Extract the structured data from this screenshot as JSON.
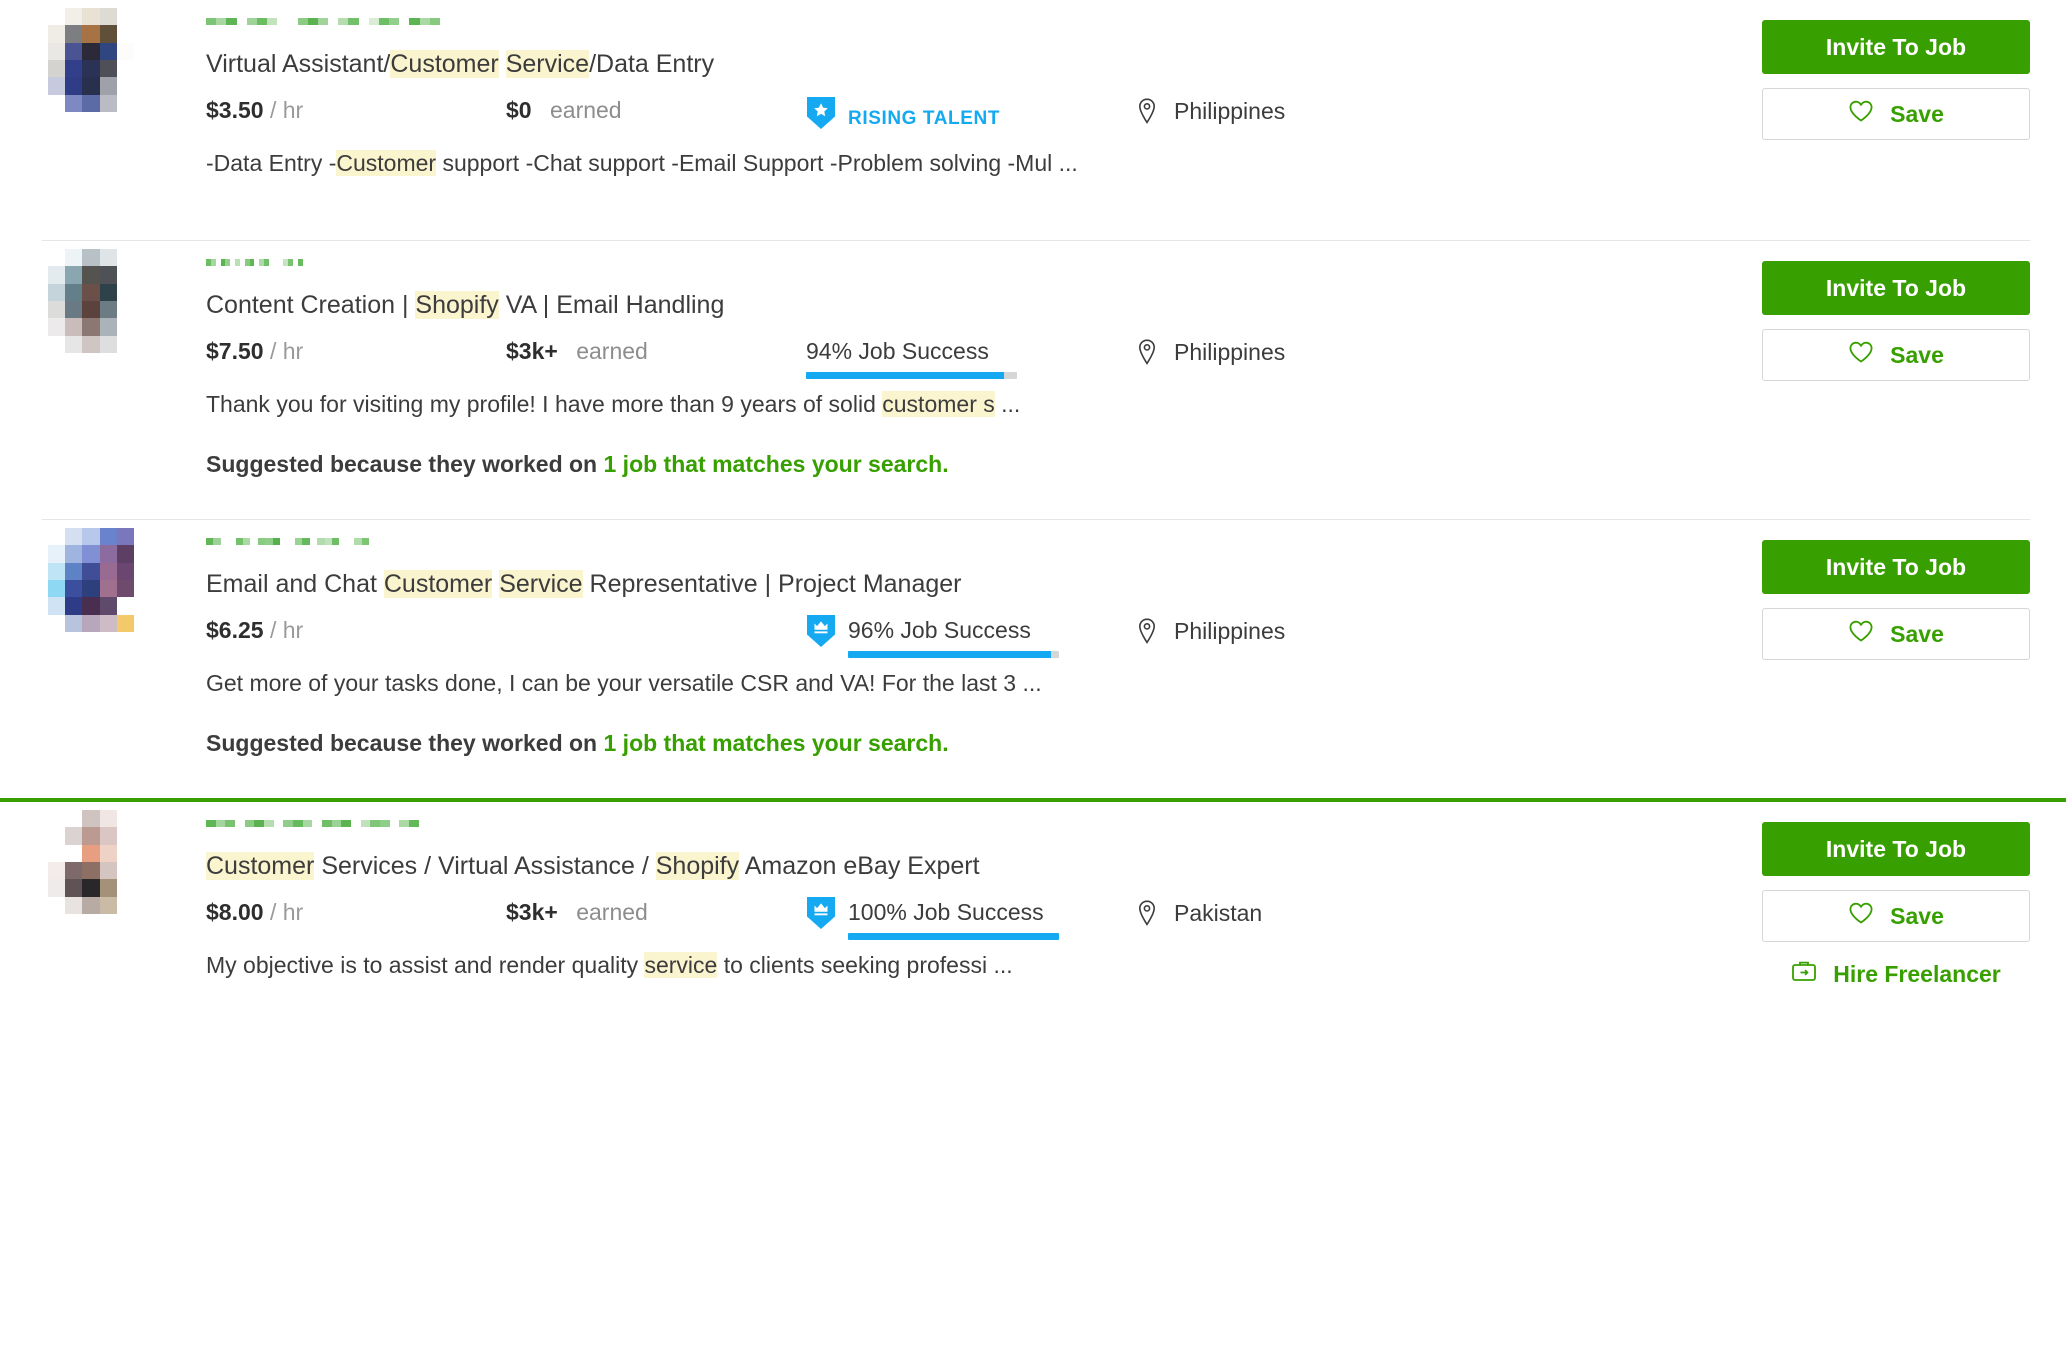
{
  "colors": {
    "brand_green": "#37a000",
    "jss_blue": "#14a9f0",
    "highlight_yellow": "#faf4cf",
    "text_dark": "#3c3c3c",
    "muted": "#8d8d8d",
    "divider": "#e4e5e7"
  },
  "actions": {
    "invite_label": "Invite To Job",
    "save_label": "Save",
    "hire_label": "Hire Freelancer"
  },
  "labels": {
    "earned": "earned",
    "per_hour": "/ hr",
    "rising_talent": "RISING TALENT",
    "suggested_prefix": "Suggested because they worked on",
    "suggested_link": "1 job that matches your search."
  },
  "cards": [
    {
      "title_parts": [
        {
          "text": "Virtual Assistant/",
          "highlight": false
        },
        {
          "text": "Customer",
          "highlight": true
        },
        {
          "text": " ",
          "highlight": false
        },
        {
          "text": "Service",
          "highlight": true
        },
        {
          "text": "/Data Entry",
          "highlight": false
        }
      ],
      "rate": "$3.50",
      "rate_unit": "/ hr",
      "earned": "$0",
      "earned_label": "earned",
      "badge_type": "rising-talent",
      "badge_label": "RISING TALENT",
      "job_success": null,
      "job_success_pct": 0,
      "location": "Philippines",
      "desc_parts": [
        {
          "text": "-Data Entry -",
          "highlight": false
        },
        {
          "text": "Customer",
          "highlight": true
        },
        {
          "text": " support -Chat support -Email Support -Problem solving -Mul ...",
          "highlight": false
        }
      ],
      "suggested": false,
      "hire_link": false,
      "avatar_colors": [
        "#ffffff",
        "#f2efe9",
        "#e9e2d4",
        "#dedbd4",
        "#ffffff",
        "#f0ede7",
        "#7d7e82",
        "#a87344",
        "#60503a",
        "#ffffff",
        "#e9e8e4",
        "#4a5493",
        "#2c2a38",
        "#2f4680",
        "#fdfcfa",
        "#d5d3cf",
        "#32408c",
        "#2a3355",
        "#4f5057",
        "#ffffff",
        "#c7cade",
        "#2f3d86",
        "#28304e",
        "#9ea1a8",
        "#ffffff",
        "#ffffff",
        "#7e89c4",
        "#5a6ba5",
        "#b9bcc2",
        "#ffffff"
      ],
      "name_blocks": [
        "#7cc576",
        "#a8d8a0",
        "#5fb555",
        "#ffffff",
        "#9ed39a",
        "#6bbd62",
        "#c3e3bd",
        "#ffffff",
        "#ffffff",
        "#8ccb84",
        "#5ab350",
        "#a0d49b",
        "#ffffff",
        "#b5ddb0",
        "#73c06a",
        "#ffffff",
        "#d8edd4",
        "#6fbe66",
        "#93cf8c",
        "#ffffff",
        "#5db452",
        "#aad9a4",
        "#87c97f",
        "#ffffff"
      ]
    },
    {
      "title_parts": [
        {
          "text": "Content Creation | ",
          "highlight": false
        },
        {
          "text": "Shopify",
          "highlight": true
        },
        {
          "text": " VA | Email Handling",
          "highlight": false
        }
      ],
      "rate": "$7.50",
      "rate_unit": "/ hr",
      "earned": "$3k+",
      "earned_label": "earned",
      "badge_type": "none",
      "badge_label": null,
      "job_success": "94% Job Success",
      "job_success_pct": 94,
      "location": "Philippines",
      "desc_parts": [
        {
          "text": "Thank you for visiting my profile! I have more than 9 years of solid ",
          "highlight": false
        },
        {
          "text": "customer",
          "highlight": true
        },
        {
          "text": " s",
          "highlight": true
        },
        {
          "text": " ...",
          "highlight": false
        }
      ],
      "suggested": true,
      "hire_link": false,
      "avatar_colors": [
        "#ffffff",
        "#eef3f5",
        "#b8c2c6",
        "#dfe5e7",
        "#ffffff",
        "#e3ebef",
        "#8aa6b1",
        "#54534f",
        "#4e5156",
        "#ffffff",
        "#c5d4da",
        "#637f89",
        "#6b504a",
        "#2e4249",
        "#ffffff",
        "#dcdcda",
        "#697a84",
        "#5b423d",
        "#6b7c85",
        "#ffffff",
        "#eceaea",
        "#c9bcbb",
        "#8b7873",
        "#a9b3b8",
        "#ffffff",
        "#ffffff",
        "#e7e6e6",
        "#cfc6c4",
        "#dcdedf",
        "#ffffff"
      ],
      "name_blocks": [
        "#6dbd64",
        "#a5d69f",
        "#ffffff",
        "#5cb451",
        "#95d08e",
        "#ffffff",
        "#b9dfb4",
        "#ffffff",
        "#88ca80",
        "#5fb655",
        "#ffffff",
        "#addaa8",
        "#72c069",
        "#ffffff",
        "#ffffff",
        "#ffffff",
        "#c6e4c1",
        "#7ac471",
        "#ffffff",
        "#68bb5f",
        "#ffffff",
        "#ffffff",
        "#ffffff",
        "#ffffff"
      ]
    },
    {
      "title_parts": [
        {
          "text": "Email and Chat ",
          "highlight": false
        },
        {
          "text": "Customer",
          "highlight": true
        },
        {
          "text": " ",
          "highlight": false
        },
        {
          "text": "Service",
          "highlight": true
        },
        {
          "text": " Representative | Project Manager",
          "highlight": false
        }
      ],
      "rate": "$6.25",
      "rate_unit": "/ hr",
      "earned": null,
      "earned_label": null,
      "badge_type": "top-rated",
      "badge_label": null,
      "job_success": "96% Job Success",
      "job_success_pct": 96,
      "location": "Philippines",
      "desc_parts": [
        {
          "text": "Get more of your tasks done, I can be your versatile CSR and VA! For the last 3 ...",
          "highlight": false
        }
      ],
      "suggested": true,
      "hire_link": false,
      "avatar_colors": [
        "#ffffff",
        "#d4e0f2",
        "#b7c8ea",
        "#6b82cc",
        "#7b77bd",
        "#e6f1fa",
        "#9fb5e0",
        "#8190d4",
        "#8c6b9e",
        "#5d3f63",
        "#bfe4f6",
        "#5e82c6",
        "#3f4e96",
        "#9a6b92",
        "#6b4670",
        "#8ed8f4",
        "#3c4f9e",
        "#2d3f7d",
        "#a0708f",
        "#6e4a6d",
        "#cfe3f5",
        "#2e3c87",
        "#4a2e50",
        "#5f4a6b",
        "#ffffff",
        "#ffffff",
        "#b8c4dd",
        "#b7a7bd",
        "#cdbcc6",
        "#f4c96a"
      ],
      "name_blocks": [
        "#62b758",
        "#9ed197",
        "#ffffff",
        "#ffffff",
        "#74c16b",
        "#aad9a4",
        "#ffffff",
        "#88cc80",
        "#8fce88",
        "#56b14b",
        "#ffffff",
        "#ffffff",
        "#9ad494",
        "#65b95c",
        "#ffffff",
        "#b2dcad",
        "#c2e2bd",
        "#6fbe66",
        "#ffffff",
        "#ffffff",
        "#b0dbab",
        "#7cc573",
        "#ffffff",
        "#ffffff"
      ]
    },
    {
      "title_parts": [
        {
          "text": "Customer",
          "highlight": true
        },
        {
          "text": " Services / Virtual Assistance / ",
          "highlight": false
        },
        {
          "text": "Shopify",
          "highlight": true
        },
        {
          "text": " Amazon eBay Expert",
          "highlight": false
        }
      ],
      "rate": "$8.00",
      "rate_unit": "/ hr",
      "earned": "$3k+",
      "earned_label": "earned",
      "badge_type": "top-rated",
      "badge_label": null,
      "job_success": "100% Job Success",
      "job_success_pct": 100,
      "location": "Pakistan",
      "desc_parts": [
        {
          "text": "My objective is to assist and render quality ",
          "highlight": false
        },
        {
          "text": "service",
          "highlight": true
        },
        {
          "text": " to clients seeking professi ...",
          "highlight": false
        }
      ],
      "suggested": false,
      "hire_link": true,
      "avatar_colors": [
        "#ffffff",
        "#ffffff",
        "#cfc4c0",
        "#f0e6e4",
        "#ffffff",
        "#ffffff",
        "#dbd3d1",
        "#bb9a91",
        "#dcc6c4",
        "#ffffff",
        "#ffffff",
        "#ffffff",
        "#e79e81",
        "#eed2c6",
        "#ffffff",
        "#f3eceb",
        "#7e6a6b",
        "#8d6f64",
        "#d4c5c1",
        "#ffffff",
        "#efebea",
        "#5f5356",
        "#2a272b",
        "#a3917a",
        "#ffffff",
        "#ffffff",
        "#e8e2e1",
        "#b8aba4",
        "#c9bba6",
        "#ffffff"
      ],
      "name_blocks": [
        "#5fb655",
        "#a3d69d",
        "#79c370",
        "#ffffff",
        "#8ccb84",
        "#5ab350",
        "#b5ddb0",
        "#ffffff",
        "#91cd8a",
        "#66ba5d",
        "#a8d8a2",
        "#ffffff",
        "#70bf67",
        "#9bd295",
        "#5cb451",
        "#ffffff",
        "#c0e1bb",
        "#7fc777",
        "#8fce88",
        "#ffffff",
        "#aad9a4",
        "#63b85a",
        "#ffffff",
        "#ffffff"
      ]
    }
  ]
}
